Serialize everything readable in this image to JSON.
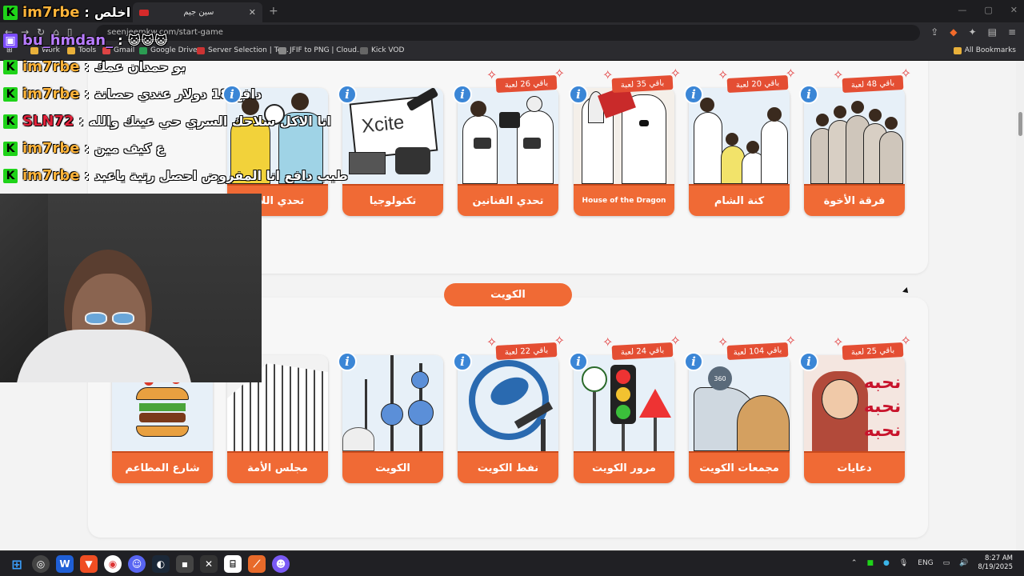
{
  "browser": {
    "tab_title": "سين جيم",
    "url": "seenjeemkw.com/start-game",
    "bookmarks": [
      "Work",
      "Tools",
      "Gmail",
      "Google Drive",
      "Server Selection | Te...",
      "JFIF to PNG | Cloud...",
      "Kick VOD"
    ],
    "all_bookmarks": "All Bookmarks"
  },
  "top_cards": [
    {
      "name": "فرقة الأخوة",
      "badge": "باقي 48 لعبة"
    },
    {
      "name": "كنة الشام",
      "badge": "باقي 20 لعبة"
    },
    {
      "name": "House of the Dragon",
      "badge": "باقي 35 لعبة"
    },
    {
      "name": "تحدي الفنانين",
      "badge": "باقي 26 لعبة"
    },
    {
      "name": "تكنولوجيا",
      "badge": ""
    },
    {
      "name": "تحدي اللاع",
      "badge": ""
    }
  ],
  "section_title": "الكويت",
  "bottom_cards": [
    {
      "name": "دعايات",
      "badge": "باقي 25 لعبة"
    },
    {
      "name": "مجمعات الكويت",
      "badge": "باقي 104 لعبة"
    },
    {
      "name": "مرور الكويت",
      "badge": "باقي 24 لعبة"
    },
    {
      "name": "نفط الكويت",
      "badge": "باقي 22 لعبة"
    },
    {
      "name": "الكويت",
      "badge": ""
    },
    {
      "name": "مجلس الأمة",
      "badge": ""
    },
    {
      "name": "شارع المطاعم",
      "badge": ""
    }
  ],
  "xcite_logo": "Xcite",
  "chat": [
    {
      "user": "im7rbe",
      "color": "#ffb43a",
      "text": "اخلص"
    },
    {
      "user": "bu_hmdan_",
      "color": "#b87cff",
      "text": ""
    },
    {
      "user": "im7rbe",
      "color": "#ffb43a",
      "text": "بو حمدان عمك"
    },
    {
      "user": "im7rbe",
      "color": "#ffb43a",
      "text": "دافع 18 دولار عندي حصانة"
    },
    {
      "user": "SLN72",
      "color": "#e0213a",
      "text": "انا الاكل سلاحك السري حي عينك والله"
    },
    {
      "user": "im7rbe",
      "color": "#ffb43a",
      "text": "ع كيف مين"
    },
    {
      "user": "im7rbe",
      "color": "#ffb43a",
      "text": "طيب دافع انا المفروض احصل رتبة ياعبد"
    }
  ],
  "taskbar": {
    "lang": "ENG",
    "time": "8:27 AM",
    "date": "8/19/2025"
  }
}
